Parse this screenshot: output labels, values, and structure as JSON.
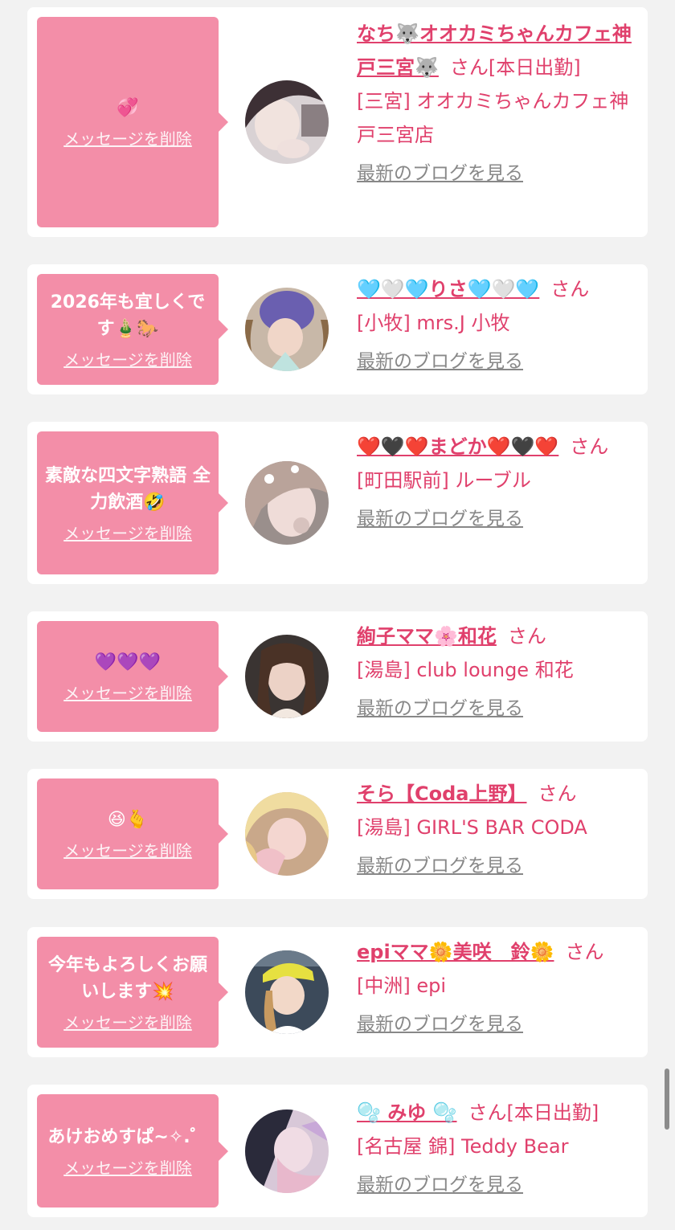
{
  "delete_label": "メッセージを削除",
  "san_label": "さん",
  "blog_label": "最新のブログを見る",
  "colors": {
    "accent": "#f38ea8",
    "name": "#e0406c",
    "muted": "#888888"
  },
  "items": [
    {
      "message": "💞",
      "name": "なち🐺オオカミちゃんカフェ神戸三宮🐺",
      "status": "[本日出勤]",
      "shop": "[三宮] オオカミちゃんカフェ神戸三宮店"
    },
    {
      "message": "2026年も宜しくです🎍🐎",
      "name": "🩵🤍🩵りさ🩵🤍🩵",
      "status": "",
      "shop": "[小牧] mrs.J 小牧"
    },
    {
      "message": "素敵な四文字熟語 全力飲酒🤣",
      "name": "❤️🖤❤️まどか❤️🖤❤️",
      "status": "",
      "shop": "[町田駅前] ルーブル"
    },
    {
      "message": "💜💜💜",
      "name": "絢子ママ🌸和花",
      "status": "",
      "shop": "[湯島] club lounge 和花"
    },
    {
      "message": "😆🫰",
      "name": "そら【Coda上野】",
      "status": "",
      "shop": "[湯島] GIRL'S BAR CODA"
    },
    {
      "message": "今年もよろしくお願いします💥",
      "name": "epiママ🌼美咲　鈴🌼",
      "status": "",
      "shop": "[中洲] epi"
    },
    {
      "message": "あけおめすぱ~✧.゜",
      "name": "🫧 みゆ 🫧",
      "status": "[本日出勤]",
      "shop": "[名古屋 錦] Teddy Bear"
    }
  ]
}
